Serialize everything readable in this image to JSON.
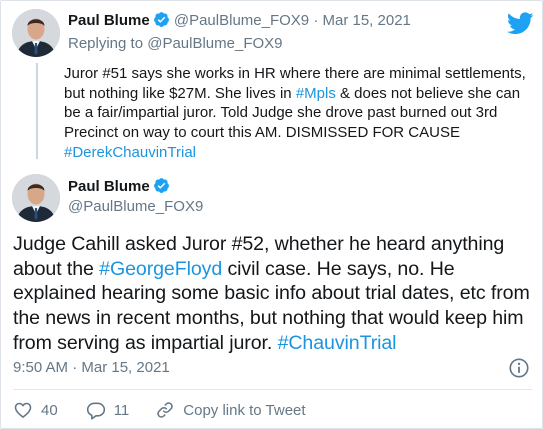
{
  "quoted_tweet": {
    "author_name": "Paul Blume",
    "author_handle": "@PaulBlume_FOX9",
    "separator": "·",
    "date": "Mar 15, 2021",
    "replying_prefix": "Replying to",
    "replying_handle": "@PaulBlume_FOX9",
    "text_before_mpls": "Juror #51 says she works in HR where there are minimal settlements, but nothing like $27M. She lives in ",
    "hashtag_mpls": "#Mpls",
    "text_after_mpls": " & does not believe she can be a fair/impartial juror. Told Judge she drove past burned out 3rd Precinct on way to court this AM. DISMISSED FOR CAUSE ",
    "hashtag_trial": "#DerekChauvinTrial"
  },
  "main_tweet": {
    "author_name": "Paul Blume",
    "author_handle": "@PaulBlume_FOX9",
    "text_before_floyd": "Judge Cahill asked Juror #52, whether he heard anything about the ",
    "hashtag_floyd": "#GeorgeFloyd",
    "text_after_floyd": " civil case. He says, no. He explained hearing some basic info about trial dates, etc from the news in recent months, but nothing that would keep him from serving as impartial juror. ",
    "hashtag_chauvin": "#ChauvinTrial",
    "timestamp": "9:50 AM · Mar 15, 2021"
  },
  "actions": {
    "like_count": "40",
    "reply_count": "11",
    "copy_link_label": "Copy link to Tweet"
  },
  "icons": {
    "brand": "twitter-bird-icon",
    "verified": "verified-badge-icon",
    "info": "info-icon",
    "like": "heart-icon",
    "reply": "reply-bubble-icon",
    "copy": "link-icon"
  },
  "colors": {
    "brand_blue": "#1da1f2",
    "hashtag_blue": "#1b95e0",
    "muted_gray": "#657786",
    "text": "#14171a"
  }
}
